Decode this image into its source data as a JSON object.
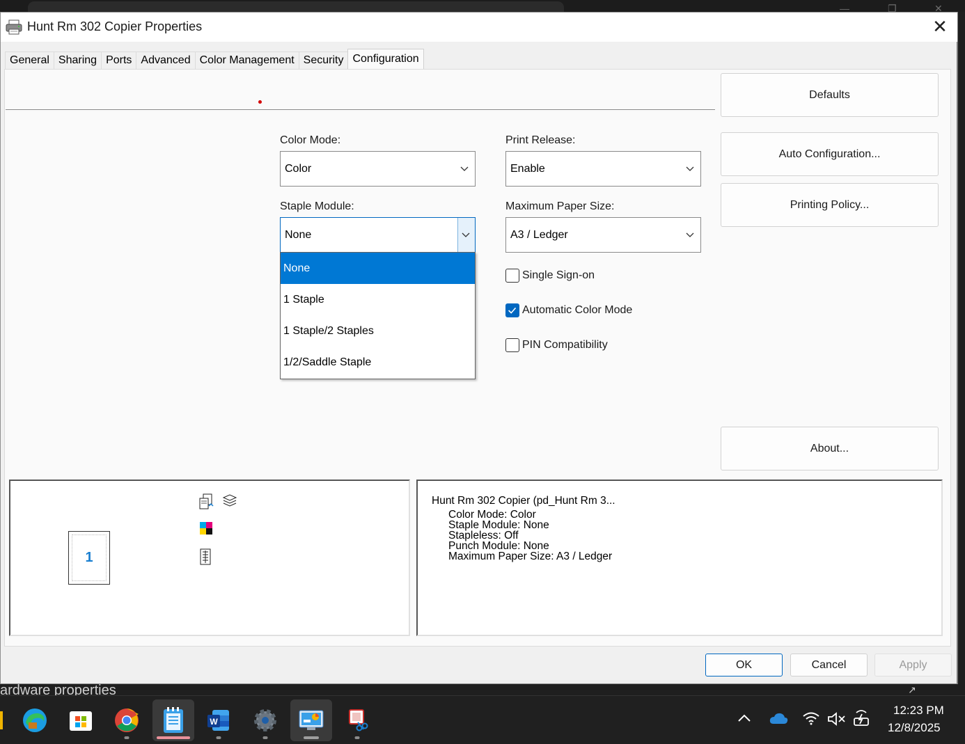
{
  "dialog": {
    "title": "Hunt Rm 302 Copier Properties",
    "close_glyph": "✕"
  },
  "tabs": [
    {
      "label": "General"
    },
    {
      "label": "Sharing"
    },
    {
      "label": "Ports"
    },
    {
      "label": "Advanced"
    },
    {
      "label": "Color Management"
    },
    {
      "label": "Security"
    },
    {
      "label": "Configuration",
      "active": true
    }
  ],
  "side_buttons": {
    "defaults": "Defaults",
    "auto_config": "Auto Configuration...",
    "printing_policy": "Printing Policy...",
    "about": "About..."
  },
  "form": {
    "color_mode": {
      "label": "Color Mode:",
      "value": "Color"
    },
    "print_release": {
      "label": "Print Release:",
      "value": "Enable"
    },
    "staple_module": {
      "label": "Staple Module:",
      "value": "None",
      "options": [
        "None",
        "1 Staple",
        "1 Staple/2 Staples",
        "1/2/Saddle Staple"
      ],
      "selected_index": 0
    },
    "max_paper_size": {
      "label": "Maximum Paper Size:",
      "value": "A3 / Ledger"
    },
    "single_sign_on": {
      "label": "Single Sign-on",
      "checked": false
    },
    "auto_color_mode": {
      "label": "Automatic Color Mode",
      "checked": true
    },
    "pin_compat": {
      "label": "PIN Compatibility",
      "checked": false
    }
  },
  "preview": {
    "page_number": "1"
  },
  "summary": {
    "header": "Hunt Rm 302 Copier (pd_Hunt Rm 3...",
    "lines": [
      "Color Mode: Color",
      "Staple Module: None",
      "Stapleless: Off",
      "Punch Module: None",
      "Maximum Paper Size: A3 / Ledger"
    ]
  },
  "buttons": {
    "ok": "OK",
    "cancel": "Cancel",
    "apply": "Apply"
  },
  "behind_window_text": "ardware properties",
  "taskbar": {
    "apps": [
      {
        "name": "edge",
        "icon": "edge-icon"
      },
      {
        "name": "microsoft-store",
        "icon": "store-icon"
      },
      {
        "name": "chrome",
        "icon": "chrome-icon"
      },
      {
        "name": "notepad",
        "icon": "notepad-icon"
      },
      {
        "name": "word",
        "icon": "word-icon"
      },
      {
        "name": "settings",
        "icon": "gear-icon"
      },
      {
        "name": "control-panel",
        "icon": "control-panel-icon"
      },
      {
        "name": "snipping-tool",
        "icon": "snipping-tool-icon"
      }
    ],
    "clock_time": "12:23 PM",
    "clock_date": "12/8/2025"
  },
  "colors": {
    "accent": "#0067c0",
    "selection": "#0078d4",
    "onedrive": "#2b88d8"
  }
}
